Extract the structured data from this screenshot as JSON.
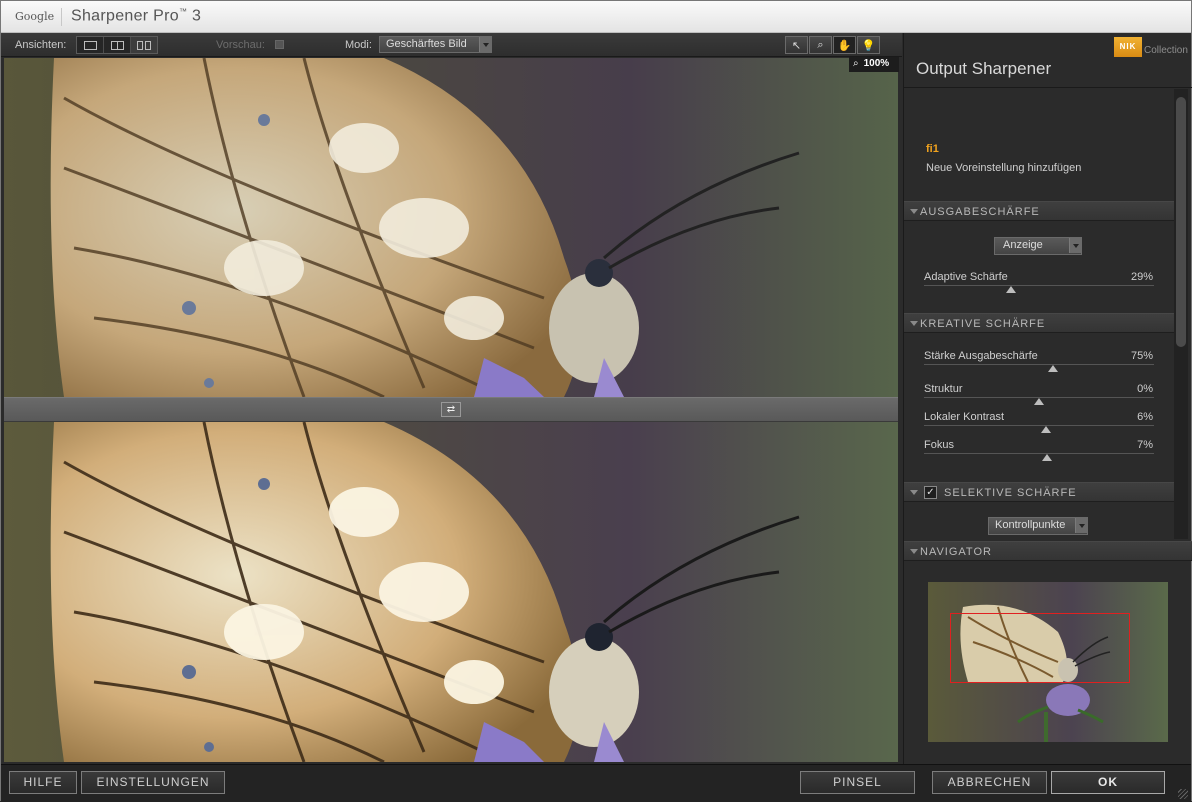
{
  "window": {
    "brand": "Google",
    "product": "Sharpener Pro",
    "trademark": "™",
    "version": "3"
  },
  "toolbar": {
    "views_label": "Ansichten:",
    "preview_label": "Vorschau:",
    "mode_label": "Modi:",
    "mode_value": "Geschärftes Bild",
    "zoom_icon": "⌕",
    "zoom_value": "100%",
    "tools": [
      "pointer-icon",
      "zoom-icon",
      "hand-icon",
      "lightbulb-icon"
    ]
  },
  "panel": {
    "logo_text": "NIK",
    "logo_collection": "Collection",
    "title": "Output Sharpener",
    "preset_name": "fi1",
    "preset_add": "Neue Voreinstellung hinzufügen",
    "sections": {
      "output": {
        "title": "AUSGABESCHÄRFE",
        "dropdown": "Anzeige",
        "sliders": [
          {
            "label": "Adaptive Schärfe",
            "value": "29%",
            "level": 29
          }
        ]
      },
      "creative": {
        "title": "KREATIVE SCHÄRFE",
        "sliders": [
          {
            "label": "Stärke Ausgabeschärfe",
            "value": "75%",
            "level": 75
          },
          {
            "label": "Struktur",
            "value": "0%",
            "level": 0
          },
          {
            "label": "Lokaler Kontrast",
            "value": "6%",
            "level": 6
          },
          {
            "label": "Fokus",
            "value": "7%",
            "level": 7
          }
        ]
      },
      "selective": {
        "title": "SELEKTIVE SCHÄRFE",
        "checked": true,
        "check_mark": "✓",
        "dropdown": "Kontrollpunkte"
      },
      "navigator": {
        "title": "NAVIGATOR"
      }
    }
  },
  "buttons": {
    "help": "HILFE",
    "settings": "EINSTELLUNGEN",
    "brush": "PINSEL",
    "cancel": "ABBRECHEN",
    "ok": "OK"
  },
  "colors": {
    "accent_orange": "#f0a21e",
    "nav_rect": "#e02020"
  }
}
